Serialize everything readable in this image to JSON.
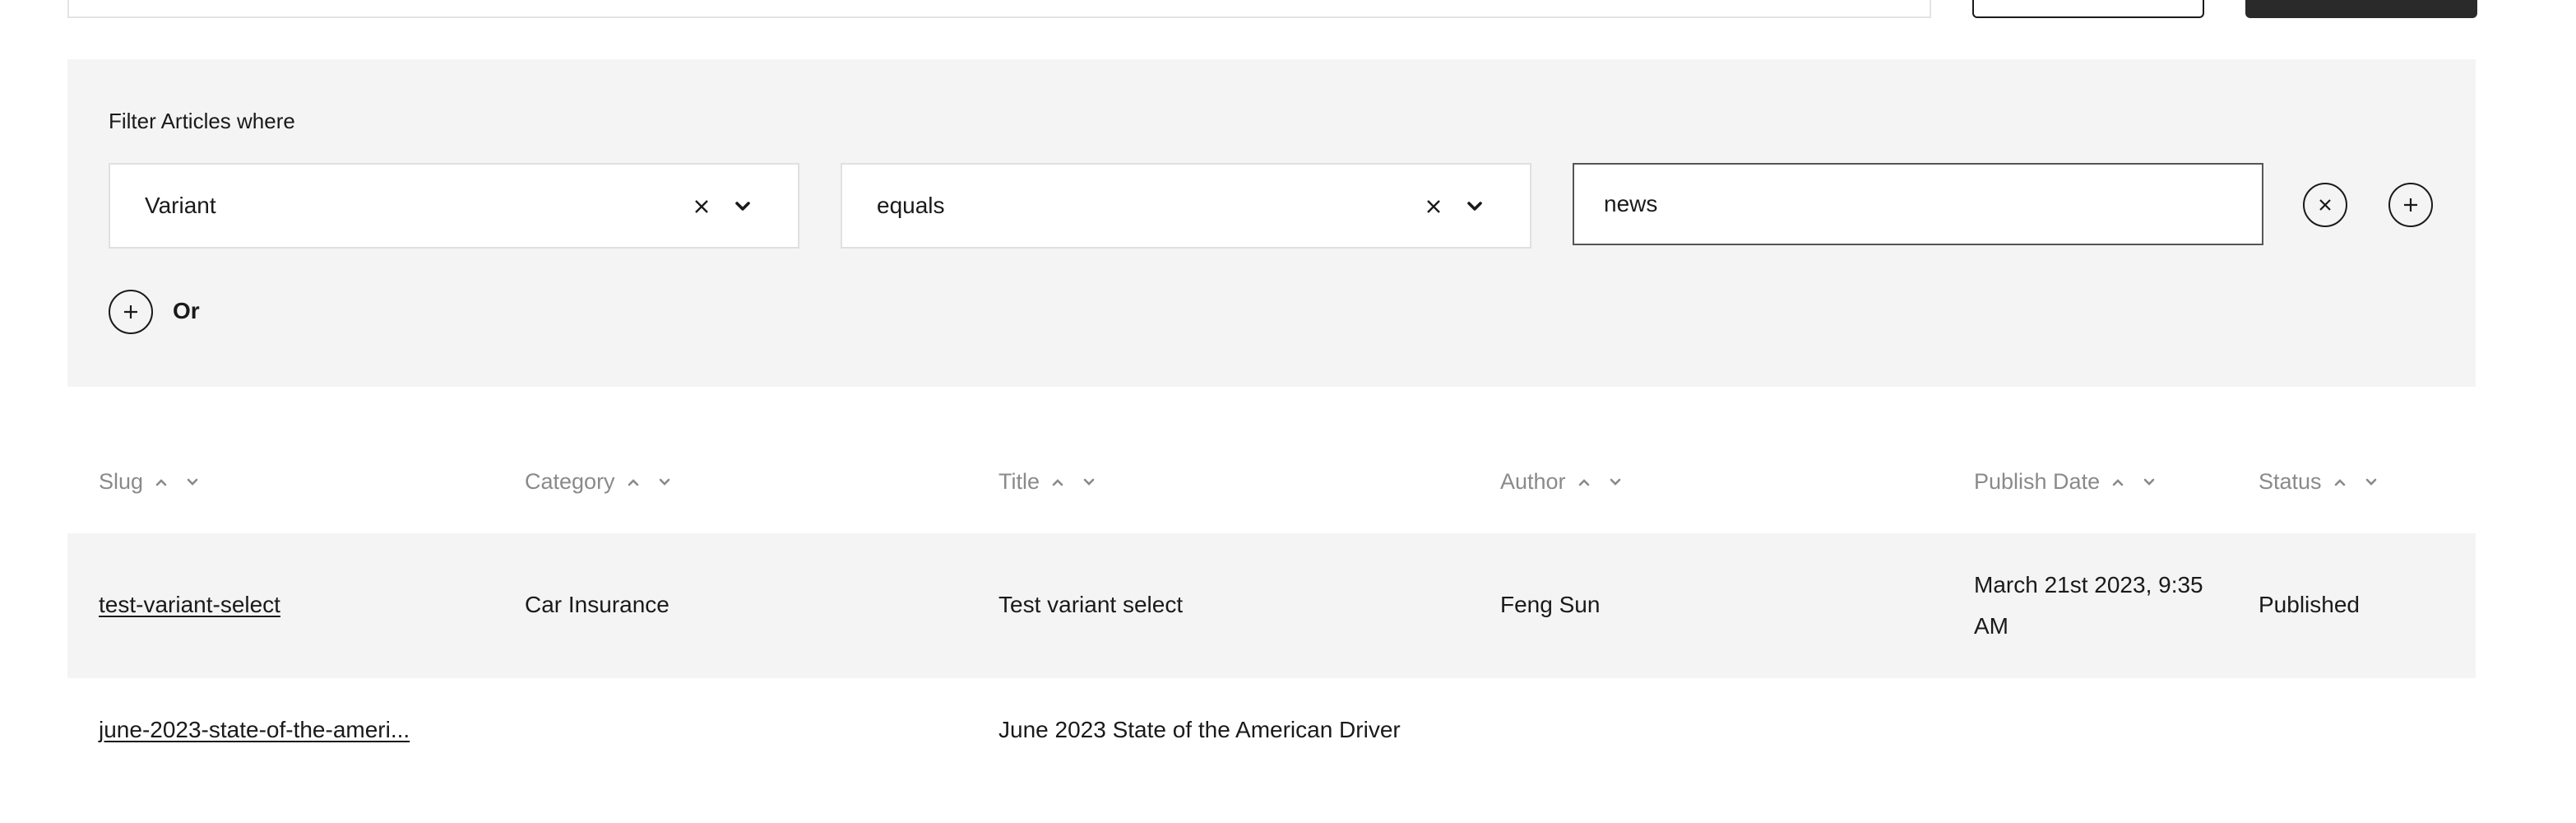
{
  "filter": {
    "heading": "Filter Articles where",
    "field_value": "Variant",
    "operator_value": "equals",
    "text_value": "news",
    "or_label": "Or"
  },
  "table": {
    "columns": [
      {
        "label": "Slug"
      },
      {
        "label": "Category"
      },
      {
        "label": "Title"
      },
      {
        "label": "Author"
      },
      {
        "label": "Publish Date"
      },
      {
        "label": "Status"
      }
    ],
    "rows": [
      {
        "slug": "test-variant-select",
        "category": "Car Insurance",
        "title": "Test variant select",
        "author": "Feng Sun",
        "publish_date": "March 21st 2023, 9:35 AM",
        "status": "Published"
      },
      {
        "slug": "june-2023-state-of-the-ameri...",
        "category": "",
        "title": "June 2023 State of the American Driver",
        "author": "",
        "publish_date": "",
        "status": ""
      }
    ]
  },
  "colors": {
    "panel_bg": "#f4f4f4",
    "header_text": "#8a8a8a",
    "dark_button": "#2a2a2a"
  }
}
